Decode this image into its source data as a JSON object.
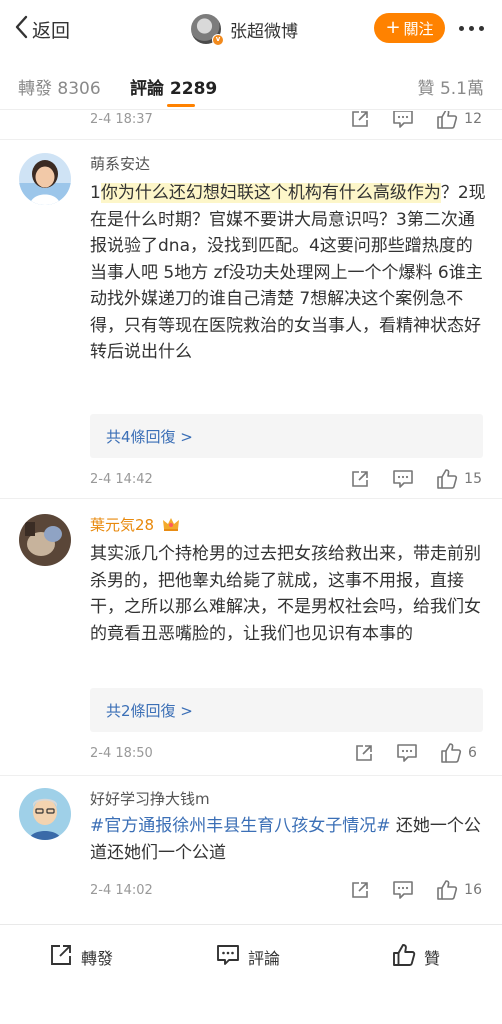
{
  "header": {
    "back_label": "返回",
    "title": "张超微博",
    "follow_label": "關注"
  },
  "tabs": {
    "repost": "轉發 8306",
    "comment": "評論 2289",
    "like": "贊 5.1萬"
  },
  "partial_item": {
    "time": "2-4 18:37",
    "likes": "12"
  },
  "comments": [
    {
      "user": "萌系安达",
      "text_prefix": "1",
      "text_highlight": "你为什么还幻想妇联这个机构有什么高级作为",
      "text_rest": "？2现在是什么时期？官媒不要讲大局意识吗？3第二次通报说验了dna，没找到匹配。4这要问那些蹭热度的当事人吧 5地方 zf没功夫处理网上一个个爆料 6谁主动找外媒递刀的谁自己清楚 7想解决这个案例急不得，只有等现在医院救治的女当事人，看精神状态好转后说出什么",
      "replies": "共4條回復 >",
      "time": "2-4 14:42",
      "likes": "15"
    },
    {
      "user": "葉元気28",
      "text": "其实派几个持枪男的过去把女孩给救出来，带走前别杀男的，把他睾丸给毙了就成，这事不用报，直接干，之所以那么难解决，不是男权社会吗，给我们女的竟看丑恶嘴脸的，让我们也见识有本事的",
      "replies": "共2條回復 >",
      "time": "2-4 18:50",
      "likes": "6"
    },
    {
      "user": "好好学习挣大钱m",
      "hashtag": "#官方通报徐州丰县生育八孩女子情况#",
      "text": " 还她一个公道还她们一个公道",
      "time": "2-4 14:02",
      "likes": "16"
    }
  ],
  "bottom_bar": {
    "repost": "轉發",
    "comment": "評論",
    "like": "贊"
  },
  "colors": {
    "accent": "#ff8200",
    "link": "#3b6fb6",
    "highlight": "#fdf6c9",
    "vip_name": "#e8890c"
  }
}
